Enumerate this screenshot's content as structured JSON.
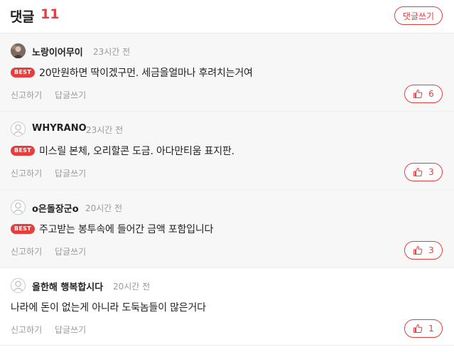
{
  "header": {
    "title": "댓글",
    "count": "11",
    "write_button": "댓글쓰기"
  },
  "colors": {
    "accent": "#e53e3e",
    "best_row_bg": "#f7f7f7",
    "muted_text": "#9a9a9a"
  },
  "comments": [
    {
      "author": "노랑이어무이",
      "time": "23시간 전",
      "best": "BEST",
      "text": "20만원하면 딱이겠구먼. 세금을얼마나 후려치는거여",
      "report": "신고하기",
      "reply": "답글쓰기",
      "likes": "6",
      "avatar_icon": "user-photo-icon"
    },
    {
      "author": "WHYRANO",
      "time": "23시간 전",
      "best": "BEST",
      "text": "미스릴 본체, 오리할콘 도금. 아다만티움 표지판.",
      "report": "신고하기",
      "reply": "답글쓰기",
      "likes": "3",
      "avatar_icon": "default-avatar-icon"
    },
    {
      "author": "o은돌장군o",
      "time": "20시간 전",
      "best": "BEST",
      "text": "주고받는 봉투속에 들어간 금액 포함입니다",
      "report": "신고하기",
      "reply": "답글쓰기",
      "likes": "3",
      "avatar_icon": "default-avatar-icon"
    },
    {
      "author": "올한해 행복합시다",
      "time": "20시간 전",
      "text": "나라에 돈이 없는게 아니라 도둑놈들이 많은거다",
      "report": "신고하기",
      "reply": "답글쓰기",
      "likes": "1",
      "avatar_icon": "default-avatar-icon"
    }
  ]
}
